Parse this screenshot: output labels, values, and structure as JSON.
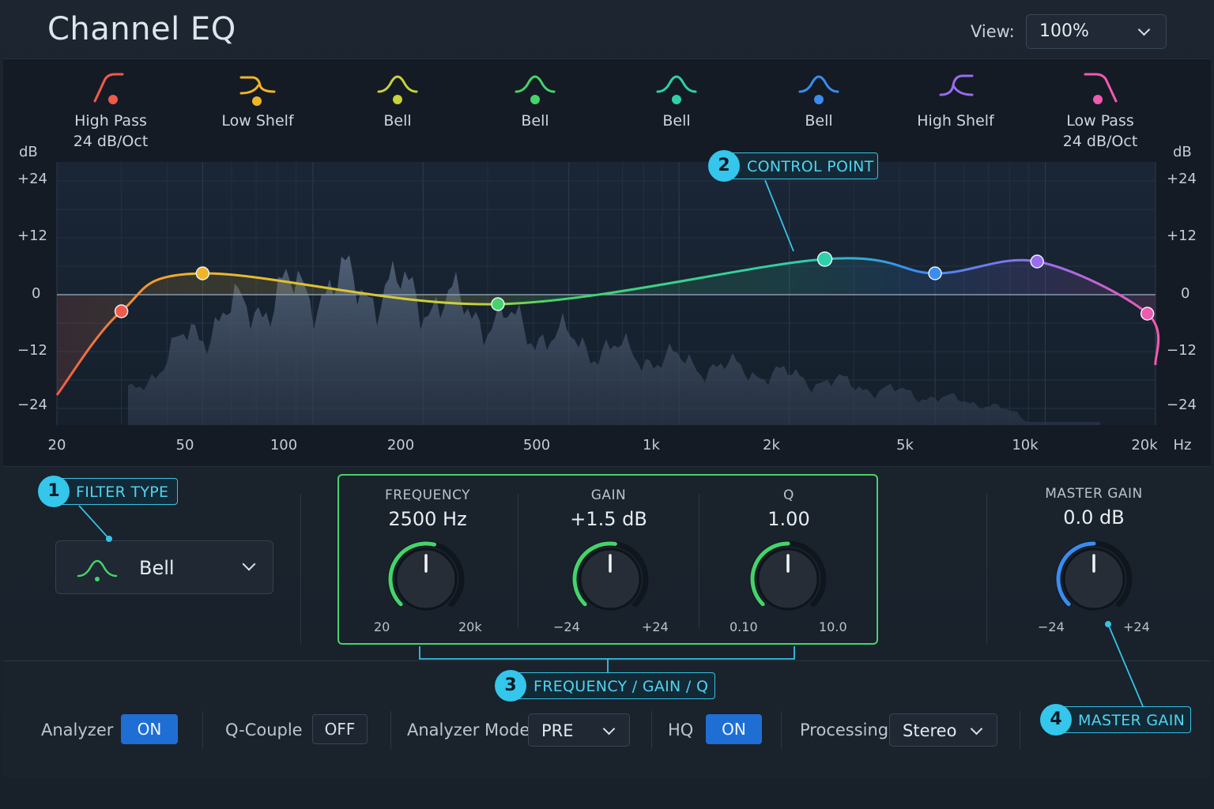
{
  "header": {
    "title": "Channel EQ",
    "view_label": "View:",
    "view_value": "100%"
  },
  "bands": [
    {
      "label": "High Pass",
      "sub": "24 dB/Oct",
      "color": "#f05a4a",
      "icon": "high-pass-icon"
    },
    {
      "label": "Low Shelf",
      "sub": "",
      "color": "#f0b428",
      "icon": "low-shelf-icon"
    },
    {
      "label": "Bell",
      "sub": "",
      "color": "#c8d23a",
      "icon": "bell-icon"
    },
    {
      "label": "Bell",
      "sub": "",
      "color": "#46d36a",
      "icon": "bell-icon"
    },
    {
      "label": "Bell",
      "sub": "",
      "color": "#2fd1a8",
      "icon": "bell-icon"
    },
    {
      "label": "Bell",
      "sub": "",
      "color": "#3a8cf0",
      "icon": "bell-icon"
    },
    {
      "label": "High Shelf",
      "sub": "",
      "color": "#9a6cf0",
      "icon": "high-shelf-icon"
    },
    {
      "label": "Low Pass",
      "sub": "24 dB/Oct",
      "color": "#f05ab0",
      "icon": "low-pass-icon"
    }
  ],
  "graph": {
    "db_unit": "dB",
    "db_ticks": [
      "+24",
      "+12",
      "0",
      "−12",
      "−24"
    ],
    "hz_ticks": [
      "20",
      "50",
      "100",
      "200",
      "500",
      "1k",
      "2k",
      "5k",
      "10k",
      "20k"
    ],
    "hz_unit": "Hz",
    "control_points": [
      {
        "freq": 30,
        "gain": -3.5,
        "color": "#f05a4a"
      },
      {
        "freq": 50,
        "gain": 4.5,
        "color": "#f0b428"
      },
      {
        "freq": 320,
        "gain": -2,
        "color": "#46d36a"
      },
      {
        "freq": 2500,
        "gain": 7.5,
        "color": "#2fd1a8"
      },
      {
        "freq": 5000,
        "gain": 4.5,
        "color": "#3a8cf0"
      },
      {
        "freq": 9500,
        "gain": 7,
        "color": "#9a6cf0"
      },
      {
        "freq": 19000,
        "gain": -4,
        "color": "#f05ab0"
      }
    ]
  },
  "filter_type": {
    "callout": "FILTER TYPE",
    "number": "1",
    "value": "Bell"
  },
  "control_point_callout": {
    "number": "2",
    "text": "CONTROL POINT"
  },
  "params": {
    "callout": "FREQUENCY / GAIN / Q",
    "number": "3",
    "frequency": {
      "name": "FREQUENCY",
      "value": "2500 Hz",
      "min": "20",
      "max": "20k",
      "fraction": 0.55
    },
    "gain": {
      "name": "GAIN",
      "value": "+1.5 dB",
      "min": "−24",
      "max": "+24",
      "fraction": 0.53
    },
    "q": {
      "name": "Q",
      "value": "1.00",
      "min": "0.10",
      "max": "10.0",
      "fraction": 0.5
    }
  },
  "master": {
    "name": "MASTER GAIN",
    "value": "0.0 dB",
    "min": "−24",
    "max": "+24",
    "fraction": 0.5,
    "callout": "MASTER GAIN",
    "number": "4"
  },
  "bottom": {
    "analyzer_label": "Analyzer",
    "analyzer_value": "ON",
    "qcouple_label": "Q-Couple",
    "qcouple_value": "OFF",
    "mode_label": "Analyzer Mode",
    "mode_value": "PRE",
    "hq_label": "HQ",
    "hq_value": "ON",
    "processing_label": "Processing",
    "processing_value": "Stereo"
  },
  "colors": {
    "accent": "#35c6ec",
    "param_box": "#46d36a",
    "toggle_on": "#1f6ed4"
  }
}
